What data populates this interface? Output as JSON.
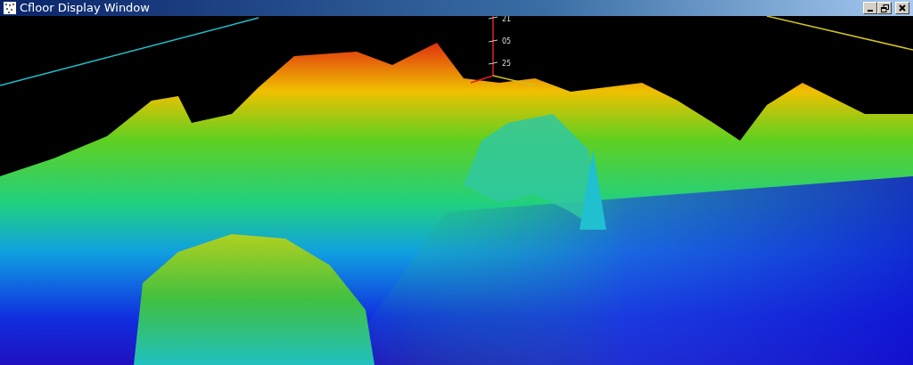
{
  "window": {
    "title": "Cfloor Display Window"
  },
  "axis": {
    "tick_labels": [
      "21",
      "05",
      "25"
    ]
  }
}
